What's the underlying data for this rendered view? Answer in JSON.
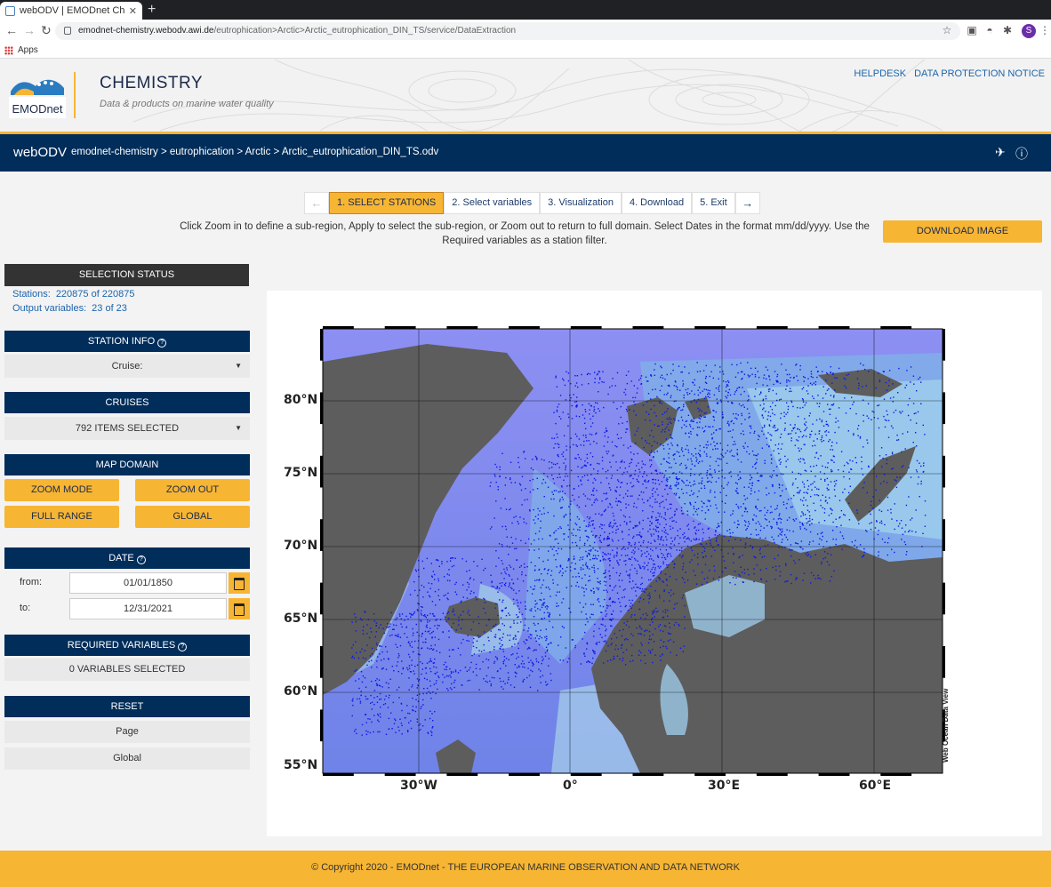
{
  "browser": {
    "tab_title": "webODV | EMODnet Chem",
    "url_host": "emodnet-chemistry.webodv.awi.de",
    "url_path": "/eutrophication>Arctic>Arctic_eutrophication_DIN_TS/service/DataExtraction",
    "bookmarks_label": "Apps",
    "profile_initial": "S"
  },
  "site": {
    "logo_text": "EMODnet",
    "title": "CHEMISTRY",
    "subtitle": "Data & products on marine water quality",
    "links": [
      "HELPDESK",
      "DATA PROTECTION NOTICE"
    ]
  },
  "odvbar": {
    "name": "webODV",
    "breadcrumb": "emodnet-chemistry > eutrophication > Arctic > Arctic_eutrophication_DIN_TS.odv"
  },
  "steps": [
    {
      "label": "1. SELECT STATIONS",
      "active": true
    },
    {
      "label": "2. Select variables",
      "active": false
    },
    {
      "label": "3. Visualization",
      "active": false
    },
    {
      "label": "4. Download",
      "active": false
    },
    {
      "label": "5. Exit",
      "active": false
    }
  ],
  "instructions": {
    "line1": "Click Zoom in to define a sub-region, Apply to select the sub-region, or Zoom out to return to full domain. Select Dates in the format mm/dd/yyyy. Use the",
    "line2": "Required variables as a station filter."
  },
  "download_image_label": "DOWNLOAD IMAGE",
  "selection_status": {
    "header": "SELECTION STATUS",
    "stations_label": "Stations:",
    "stations_value": "220875 of 220875",
    "output_label": "Output variables:",
    "output_value": "23 of 23"
  },
  "station_info": {
    "header": "STATION INFO",
    "cruise_label": "Cruise:"
  },
  "cruises": {
    "header": "CRUISES",
    "value": "792 ITEMS SELECTED"
  },
  "map_domain": {
    "header": "MAP DOMAIN",
    "zoom_mode": "ZOOM MODE",
    "zoom_out": "ZOOM OUT",
    "full_range": "FULL RANGE",
    "global": "GLOBAL"
  },
  "date": {
    "header": "DATE",
    "from_label": "from:",
    "from_value": "01/01/1850",
    "to_label": "to:",
    "to_value": "12/31/2021"
  },
  "required_variables": {
    "header": "REQUIRED VARIABLES",
    "value": "0 VARIABLES SELECTED"
  },
  "reset": {
    "header": "RESET",
    "page": "Page",
    "global": "Global"
  },
  "map": {
    "lat_labels": [
      "80°N",
      "75°N",
      "70°N",
      "65°N",
      "60°N",
      "55°N"
    ],
    "lon_labels": [
      "30°W",
      "0°",
      "30°E",
      "60°E"
    ],
    "watermark": "Web Ocean Data View",
    "station_color": "#0a18e8"
  },
  "footer": "© Copyright 2020 - EMODnet - THE EUROPEAN MARINE OBSERVATION AND DATA NETWORK"
}
